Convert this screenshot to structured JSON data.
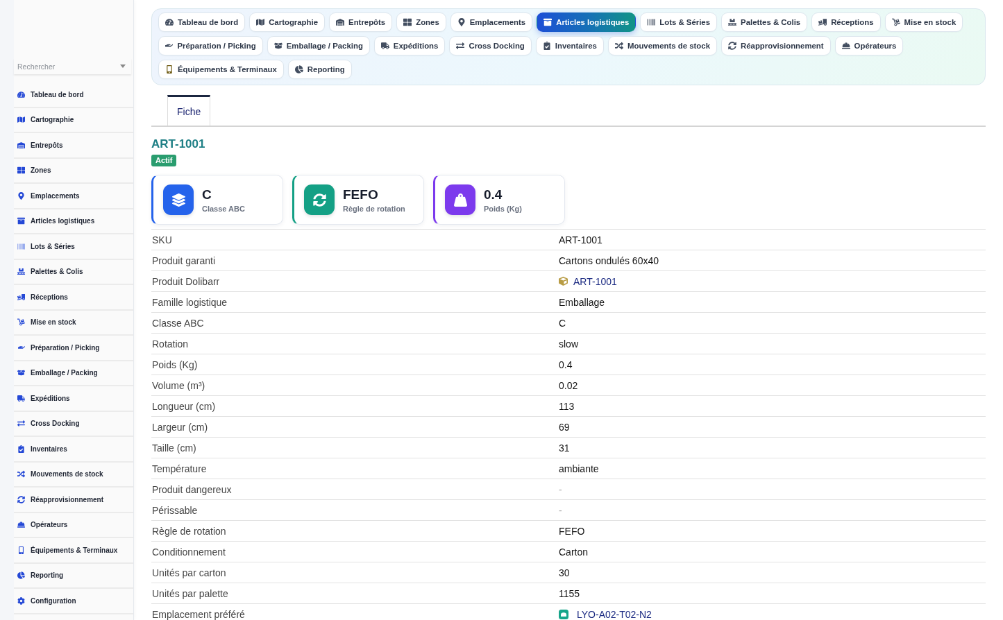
{
  "sidebar": {
    "search": {
      "placeholder": "Rechercher"
    },
    "items": [
      "Tableau de bord",
      "Cartographie",
      "Entrepôts",
      "Zones",
      "Emplacements",
      "Articles logistiques",
      "Lots & Séries",
      "Palettes & Colis",
      "Réceptions",
      "Mise en stock",
      "Préparation / Picking",
      "Emballage / Packing",
      "Expéditions",
      "Cross Docking",
      "Inventaires",
      "Mouvements de stock",
      "Réapprovisionnement",
      "Opérateurs",
      "Équipements & Terminaux",
      "Reporting",
      "Configuration"
    ]
  },
  "nav": {
    "items": [
      {
        "label": "Tableau de bord",
        "selected": false
      },
      {
        "label": "Cartographie",
        "selected": false
      },
      {
        "label": "Entrepôts",
        "selected": false
      },
      {
        "label": "Zones",
        "selected": false
      },
      {
        "label": "Emplacements",
        "selected": false
      },
      {
        "label": "Articles logistiques",
        "selected": true
      },
      {
        "label": "Lots & Séries",
        "selected": false
      },
      {
        "label": "Palettes & Colis",
        "selected": false
      },
      {
        "label": "Réceptions",
        "selected": false
      },
      {
        "label": "Mise en stock",
        "selected": false
      },
      {
        "label": "Préparation / Picking",
        "selected": false
      },
      {
        "label": "Emballage / Packing",
        "selected": false
      },
      {
        "label": "Expéditions",
        "selected": false
      },
      {
        "label": "Cross Docking",
        "selected": false
      },
      {
        "label": "Inventaires",
        "selected": false
      },
      {
        "label": "Mouvements de stock",
        "selected": false
      },
      {
        "label": "Réapprovisionnement",
        "selected": false
      },
      {
        "label": "Opérateurs",
        "selected": false
      },
      {
        "label": "Équipements & Terminaux",
        "selected": false
      },
      {
        "label": "Reporting",
        "selected": false
      }
    ]
  },
  "tabs": [
    {
      "label": "Fiche",
      "selected": true
    }
  ],
  "record": {
    "title": "ART-1001",
    "status": "Actif"
  },
  "cards": [
    {
      "value": "C",
      "label": "Classe ABC",
      "color": "#2563eb"
    },
    {
      "value": "FEFO",
      "label": "Règle de rotation",
      "color": "#14a085"
    },
    {
      "value": "0.4",
      "label": "Poids (Kg)",
      "color": "#7c3aed"
    }
  ],
  "details": [
    {
      "label": "SKU",
      "value": "ART-1001",
      "kind": "text"
    },
    {
      "label": "Produit garanti",
      "value": "Cartons ondulés 60x40",
      "kind": "text"
    },
    {
      "label": "Produit Dolibarr",
      "value": "ART-1001",
      "kind": "product"
    },
    {
      "label": "Famille logistique",
      "value": "Emballage",
      "kind": "text"
    },
    {
      "label": "Classe ABC",
      "value": "C",
      "kind": "text"
    },
    {
      "label": "Rotation",
      "value": "slow",
      "kind": "text"
    },
    {
      "label": "Poids (Kg)",
      "value": "0.4",
      "kind": "text"
    },
    {
      "label": "Volume (m³)",
      "value": "0.02",
      "kind": "text"
    },
    {
      "label": "Longueur (cm)",
      "value": "113",
      "kind": "text"
    },
    {
      "label": "Largeur (cm)",
      "value": "69",
      "kind": "text"
    },
    {
      "label": "Taille (cm)",
      "value": "31",
      "kind": "text"
    },
    {
      "label": "Température",
      "value": "ambiante",
      "kind": "text"
    },
    {
      "label": "Produit dangereux",
      "value": "-",
      "kind": "muted"
    },
    {
      "label": "Périssable",
      "value": "-",
      "kind": "muted"
    },
    {
      "label": "Règle de rotation",
      "value": "FEFO",
      "kind": "text"
    },
    {
      "label": "Conditionnement",
      "value": "Carton",
      "kind": "text"
    },
    {
      "label": "Unités par carton",
      "value": "30",
      "kind": "text"
    },
    {
      "label": "Unités par palette",
      "value": "1155",
      "kind": "text"
    },
    {
      "label": "Emplacement préféré",
      "value": "LYO-A02-T02-N2",
      "kind": "location"
    }
  ]
}
